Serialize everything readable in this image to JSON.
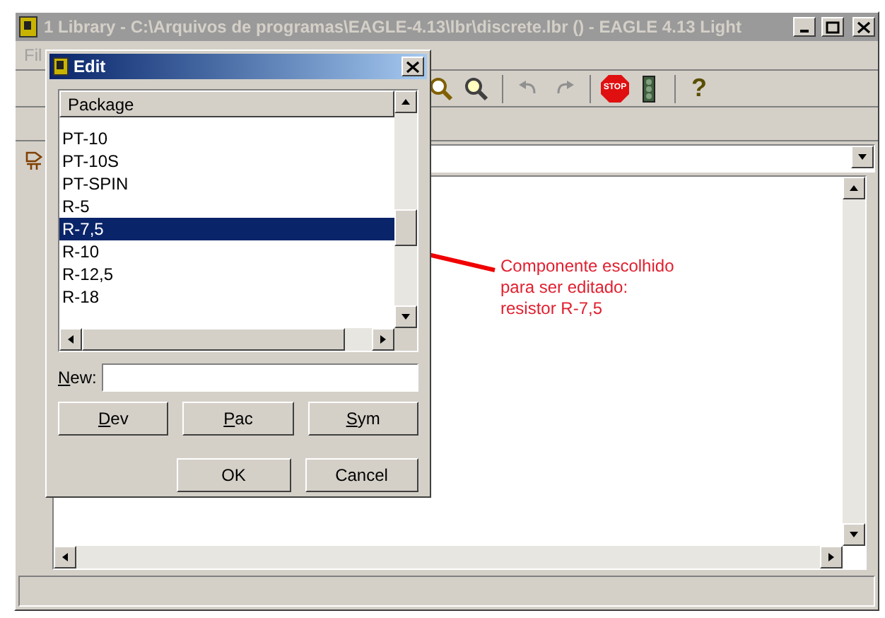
{
  "window": {
    "title": "1 Library - C:\\Arquivos de programas\\EAGLE-4.13\\lbr\\discrete.lbr () - EAGLE 4.13 Light"
  },
  "menu": [
    "Fil"
  ],
  "toolbar": {
    "stop_label": "STOP",
    "help_label": "?"
  },
  "dialog": {
    "title": "Edit",
    "column": "Package",
    "items": [
      {
        "label": "PT-10",
        "selected": false
      },
      {
        "label": "PT-10S",
        "selected": false
      },
      {
        "label": "PT-SPIN",
        "selected": false
      },
      {
        "label": "R-5",
        "selected": false
      },
      {
        "label": "R-7,5",
        "selected": true
      },
      {
        "label": "R-10",
        "selected": false
      },
      {
        "label": "R-12,5",
        "selected": false
      },
      {
        "label": "R-18",
        "selected": false
      }
    ],
    "new_label": "New:",
    "buttons": [
      {
        "label": "Dev",
        "accelerator": true
      },
      {
        "label": "Pac",
        "accelerator": true
      },
      {
        "label": "Sym",
        "accelerator": true
      }
    ],
    "actions": [
      {
        "label": "OK",
        "accelerator": false
      },
      {
        "label": "Cancel",
        "accelerator": false
      }
    ]
  },
  "annotation": {
    "lines": [
      "Componente escolhido",
      "para ser editado:",
      "resistor R-7,5"
    ]
  }
}
